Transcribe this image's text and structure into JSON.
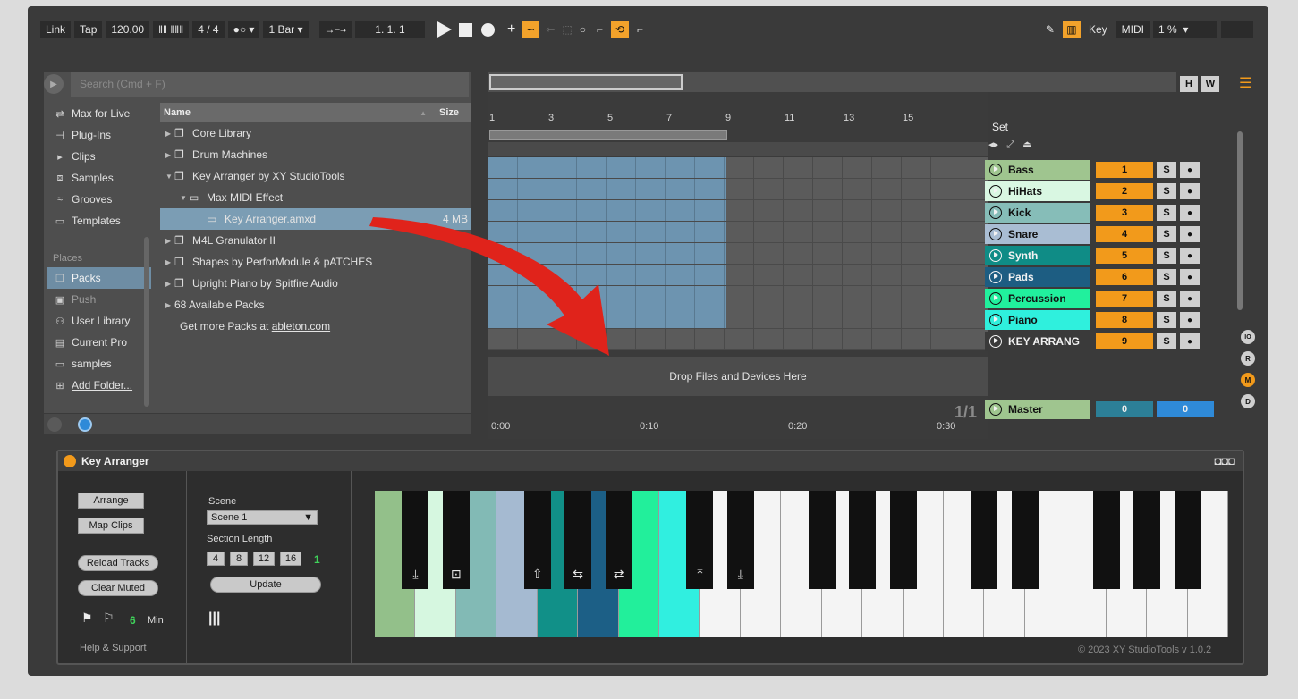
{
  "transport": {
    "link": "Link",
    "tap": "Tap",
    "tempo": "120.00",
    "meter_num": "4",
    "meter_den": "4",
    "quantize": "1 Bar",
    "position": "1.  1.  1",
    "key": "Key",
    "midi": "MIDI",
    "cpu": "1 %",
    "h": "H",
    "w": "W"
  },
  "browser": {
    "search_placeholder": "Search (Cmd + F)",
    "categories": [
      {
        "label": "Max for Live",
        "icon": "max-icon"
      },
      {
        "label": "Plug-Ins",
        "icon": "plugin-icon"
      },
      {
        "label": "Clips",
        "icon": "clip-icon"
      },
      {
        "label": "Samples",
        "icon": "waveform-icon"
      },
      {
        "label": "Grooves",
        "icon": "groove-icon"
      },
      {
        "label": "Templates",
        "icon": "template-icon"
      }
    ],
    "places_label": "Places",
    "places": [
      {
        "label": "Packs",
        "icon": "packs-icon"
      },
      {
        "label": "Push",
        "icon": "push-icon"
      },
      {
        "label": "User Library",
        "icon": "user-icon"
      },
      {
        "label": "Current Pro",
        "icon": "project-icon"
      },
      {
        "label": "samples",
        "icon": "folder-icon"
      },
      {
        "label": "Add Folder...",
        "icon": "add-folder-icon"
      }
    ],
    "col_name": "Name",
    "col_size": "Size",
    "files": [
      {
        "label": "Core Library",
        "size": ""
      },
      {
        "label": "Drum Machines",
        "size": ""
      },
      {
        "label": "Key Arranger by XY StudioTools",
        "size": ""
      },
      {
        "label": "Max MIDI Effect",
        "size": ""
      },
      {
        "label": "Key Arranger.amxd",
        "size": "4 MB"
      },
      {
        "label": "M4L Granulator II",
        "size": ""
      },
      {
        "label": "Shapes by PerforModule & pATCHES",
        "size": ""
      },
      {
        "label": "Upright Piano by Spitfire Audio",
        "size": ""
      },
      {
        "label": "68 Available Packs",
        "size": ""
      }
    ],
    "more_prefix": "Get more Packs at ",
    "more_link": "ableton.com"
  },
  "arrangement": {
    "ruler": [
      "1",
      "3",
      "5",
      "7",
      "9",
      "11",
      "13",
      "15"
    ],
    "time_ticks": [
      "0:00",
      "0:10",
      "0:20",
      "0:30"
    ],
    "drop_text": "Drop Files and Devices Here",
    "page_indicator": "1/1",
    "set_label": "Set"
  },
  "tracks": [
    {
      "name": "Bass",
      "num": "1",
      "color": "#9fc58f"
    },
    {
      "name": "HiHats",
      "num": "2",
      "color": "#d9f7e2"
    },
    {
      "name": "Kick",
      "num": "3",
      "color": "#86bdb8"
    },
    {
      "name": "Snare",
      "num": "4",
      "color": "#a9bdd3"
    },
    {
      "name": "Synth",
      "num": "5",
      "color": "#0f8c86"
    },
    {
      "name": "Pads",
      "num": "6",
      "color": "#1d5d82"
    },
    {
      "name": "Percussion",
      "num": "7",
      "color": "#21f09d"
    },
    {
      "name": "Piano",
      "num": "8",
      "color": "#2ff0dd"
    },
    {
      "name": "KEY ARRANG",
      "num": "9",
      "color": "#3a3a3a"
    }
  ],
  "master": {
    "name": "Master",
    "num": "0",
    "num2": "0",
    "color": "#9fc58f"
  },
  "solo_label": "S",
  "side_buttons": [
    "IO",
    "R",
    "M",
    "D"
  ],
  "device": {
    "title": "Key Arranger",
    "arrange": "Arrange",
    "map_clips": "Map Clips",
    "reload_tracks": "Reload Tracks",
    "clear_muted": "Clear Muted",
    "min_value": "6",
    "min_label": "Min",
    "help": "Help & Support",
    "scene_label": "Scene",
    "scene_value": "Scene 1",
    "section_length_label": "Section Length",
    "section_options": [
      "4",
      "8",
      "12",
      "16"
    ],
    "section_selected": "1",
    "update": "Update",
    "copyright": "© 2023 XY StudioTools v 1.0.2",
    "white_key_colors": [
      "#93c08a",
      "#d6f7e0",
      "#82bab5",
      "#a5bad1",
      "#119088",
      "#1c5f86",
      "#22ef9b",
      "#30efe0",
      "#f4f4f4",
      "#f4f4f4",
      "#f4f4f4",
      "#f4f4f4",
      "#f4f4f4",
      "#f4f4f4",
      "#f4f4f4",
      "#f4f4f4",
      "#f4f4f4",
      "#f4f4f4",
      "#f4f4f4",
      "#f4f4f4",
      "#f4f4f4"
    ],
    "black_key_glyphs": [
      "⤓",
      "⊡",
      "⇧",
      "⇆",
      "⇄",
      "⤒",
      "⤓",
      "",
      "",
      "",
      "",
      "",
      "",
      "",
      ""
    ]
  },
  "colors": {
    "accent": "#f29a1b",
    "clip": "#6d94b0",
    "selected_browser": "#7b9db4",
    "master_blue": "#2f8ad8",
    "master_teal": "#2c7f97"
  }
}
